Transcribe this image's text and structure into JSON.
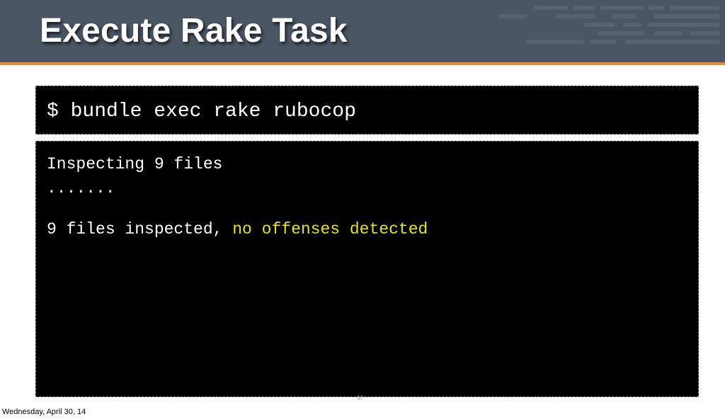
{
  "slide": {
    "title": "Execute Rake Task",
    "number": "37"
  },
  "terminal": {
    "command": "$ bundle exec rake rubocop",
    "output": {
      "line1": "Inspecting 9 files",
      "line2": ".......",
      "line3_plain": "9 files inspected, ",
      "line3_highlight": "no offenses detected"
    }
  },
  "footer": {
    "date": "Wednesday, April 30, 14"
  },
  "colors": {
    "header_bg": "#4a5664",
    "accent_rule": "#e8902a",
    "terminal_bg": "#000000",
    "highlight_text": "#e6e600"
  }
}
